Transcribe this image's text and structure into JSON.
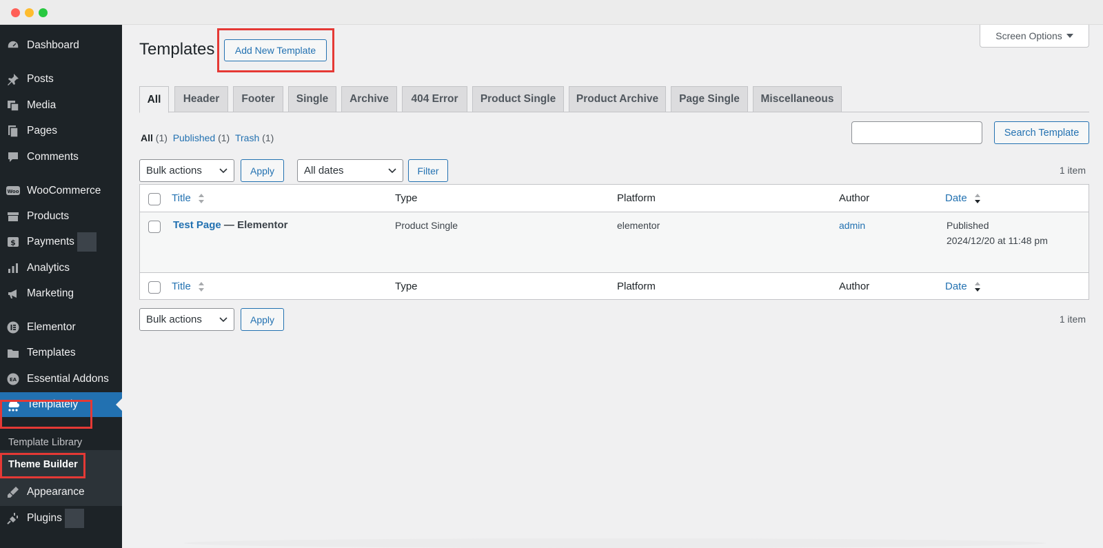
{
  "window": {
    "controls": [
      "close",
      "minimize",
      "maximize"
    ]
  },
  "sidebar": {
    "items": [
      {
        "label": "Dashboard",
        "icon": "dashboard-icon"
      },
      {
        "label": "Posts",
        "icon": "pin-icon"
      },
      {
        "label": "Media",
        "icon": "media-icon"
      },
      {
        "label": "Pages",
        "icon": "pages-icon"
      },
      {
        "label": "Comments",
        "icon": "comment-icon"
      },
      {
        "label": "WooCommerce",
        "icon": "woo-icon"
      },
      {
        "label": "Products",
        "icon": "archive-icon"
      },
      {
        "label": "Payments",
        "icon": "dollar-icon"
      },
      {
        "label": "Analytics",
        "icon": "bar-chart-icon"
      },
      {
        "label": "Marketing",
        "icon": "megaphone-icon"
      },
      {
        "label": "Elementor",
        "icon": "elementor-icon"
      },
      {
        "label": "Templates",
        "icon": "folder-icon"
      },
      {
        "label": "Essential Addons",
        "icon": "ea-icon"
      },
      {
        "label": "Templately",
        "icon": "templately-icon",
        "active": true
      },
      {
        "label": "Appearance",
        "icon": "brush-icon"
      },
      {
        "label": "Plugins",
        "icon": "plug-icon"
      }
    ],
    "submenu": [
      {
        "label": "Template Library"
      },
      {
        "label": "Theme Builder",
        "current": true
      }
    ]
  },
  "header": {
    "title": "Templates",
    "add_new_label": "Add New Template",
    "screen_options_label": "Screen Options"
  },
  "tabs": [
    {
      "label": "All",
      "active": true
    },
    {
      "label": "Header"
    },
    {
      "label": "Footer"
    },
    {
      "label": "Single"
    },
    {
      "label": "Archive"
    },
    {
      "label": "404 Error"
    },
    {
      "label": "Product Single"
    },
    {
      "label": "Product Archive"
    },
    {
      "label": "Page Single"
    },
    {
      "label": "Miscellaneous"
    }
  ],
  "filters": {
    "all_label": "All",
    "all_count": "(1)",
    "published_label": "Published",
    "published_count": "(1)",
    "trash_label": "Trash",
    "trash_count": "(1)"
  },
  "search": {
    "value": "",
    "button_label": "Search Template"
  },
  "toolbar": {
    "bulk_actions": "Bulk actions",
    "apply_label": "Apply",
    "dates": "All dates",
    "filter_label": "Filter",
    "count": "1 item"
  },
  "table": {
    "columns": [
      "Title",
      "Type",
      "Platform",
      "Author",
      "Date"
    ],
    "rows": [
      {
        "title": "Test Page",
        "title_suffix": "— Elementor",
        "type": "Product Single",
        "platform": "elementor",
        "author": "admin",
        "status": "Published",
        "date": "2024/12/20 at 11:48 pm"
      }
    ]
  },
  "highlights": {
    "color": "#e53935"
  },
  "colors": {
    "accent": "#2271b1",
    "sidebar": "#1d2327"
  }
}
